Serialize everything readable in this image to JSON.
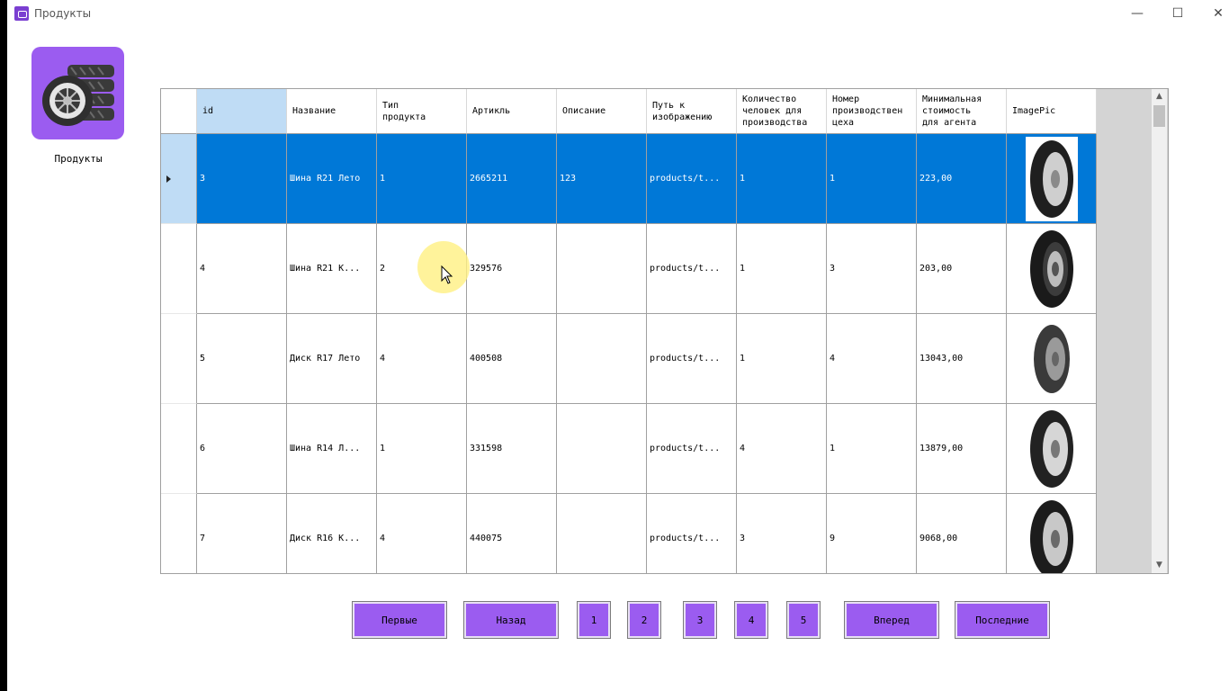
{
  "window": {
    "title": "Продукты",
    "controls": {
      "minimize": "—",
      "maximize": "☐",
      "close": "✕"
    }
  },
  "sidebar": {
    "logo_label": "Продукты"
  },
  "table": {
    "columns": [
      "id",
      "Название",
      "Тип\nпродукта",
      "Артикль",
      "Описание",
      "Путь к\nизображению",
      "Количество\nчеловек для\nпроизводства",
      "Номер\nпроизводствен\nцеха",
      "Минимальная\nстоимость\nдля агента",
      "ImagePic"
    ],
    "rows": [
      {
        "id": "3",
        "name": "Шина R21 Лето",
        "type": "1",
        "article": "2665211",
        "description": "123",
        "path": "products/t...",
        "people": "1",
        "workshop": "1",
        "min_cost": "223,00",
        "image": "tire-image",
        "selected": true
      },
      {
        "id": "4",
        "name": "Шина R21 К...",
        "type": "2",
        "article": "329576",
        "description": "",
        "path": "products/t...",
        "people": "1",
        "workshop": "3",
        "min_cost": "203,00",
        "image": "tire-image"
      },
      {
        "id": "5",
        "name": "Диск R17 Лето",
        "type": "4",
        "article": "400508",
        "description": "",
        "path": "products/t...",
        "people": "1",
        "workshop": "4",
        "min_cost": "13043,00",
        "image": "tire-image"
      },
      {
        "id": "6",
        "name": "Шина R14 Л...",
        "type": "1",
        "article": "331598",
        "description": "",
        "path": "products/t...",
        "people": "4",
        "workshop": "1",
        "min_cost": "13879,00",
        "image": "tire-image"
      },
      {
        "id": "7",
        "name": "Диск R16 К...",
        "type": "4",
        "article": "440075",
        "description": "",
        "path": "products/t...",
        "people": "3",
        "workshop": "9",
        "min_cost": "9068,00",
        "image": "tire-image"
      }
    ]
  },
  "pagination": {
    "first": "Первые",
    "back": "Назад",
    "pages": [
      "1",
      "2",
      "3",
      "4",
      "5"
    ],
    "forward": "Вперед",
    "last": "Последние"
  },
  "colors": {
    "accent": "#9b5cf0",
    "selection": "#0078d7",
    "header_selection": "#bfdcf5"
  }
}
